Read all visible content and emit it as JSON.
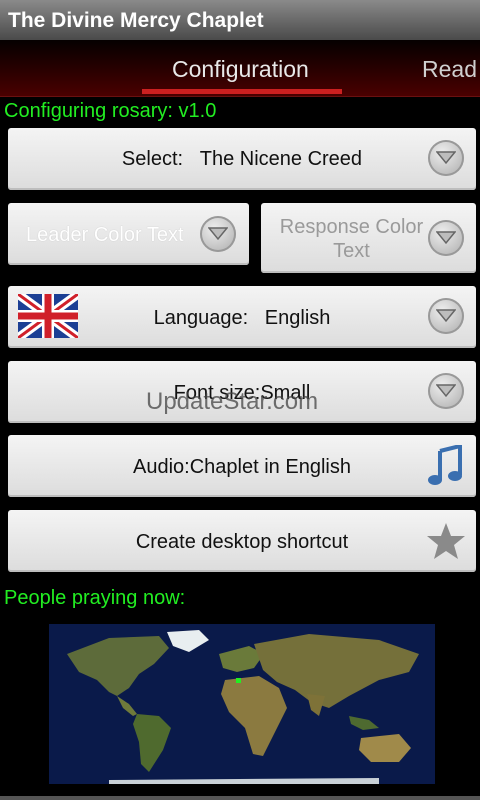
{
  "app": {
    "title": "The Divine Mercy Chaplet"
  },
  "tabs": {
    "config": "Configuration",
    "read": "Read"
  },
  "status": {
    "configuring": "Configuring rosary: v1.0"
  },
  "rows": {
    "select": {
      "label": "Select:",
      "value": "The Nicene Creed"
    },
    "leader_color": "Leader Color Text",
    "response_color": "Response Color Text",
    "language": {
      "label": "Language:",
      "value": "English"
    },
    "font_size": "Font size:Small",
    "audio": "Audio:Chaplet in English",
    "shortcut": "Create desktop shortcut"
  },
  "people_praying": "People praying now:",
  "watermark": "UpdateStar.com",
  "icons": {
    "dropdown": "chevron-down-icon",
    "flag": "uk-flag-icon",
    "audio": "music-note-icon",
    "shortcut": "star-icon",
    "map": "world-map"
  },
  "colors": {
    "green_text": "#22ee22",
    "accent_red": "#cc2020"
  }
}
